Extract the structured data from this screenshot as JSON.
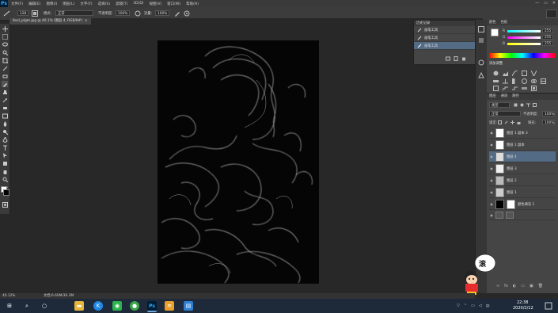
{
  "menubar": {
    "logo": "Ps",
    "items": [
      "文件(F)",
      "编辑(E)",
      "图像(I)",
      "图层(L)",
      "文字(Y)",
      "选择(S)",
      "滤镜(T)",
      "3D(D)",
      "视图(V)",
      "窗口(W)",
      "帮助(H)"
    ],
    "controls": [
      "—",
      "▭",
      "✕"
    ]
  },
  "optbar": {
    "size_value": "128",
    "mode_label": "模式:",
    "mode_value": "正常",
    "opacity_label": "不透明度:",
    "opacity_value": "100%",
    "flow_label": "流量:",
    "flow_value": "100%"
  },
  "document": {
    "tab_title": "8xxl_plgm.jpg @ 40.1% (图层 4, RGB/8#)",
    "tab_close": "×"
  },
  "history": {
    "header": "历史记录",
    "items": [
      "画笔工具",
      "画笔工具",
      "画笔工具"
    ],
    "selected_index": 2
  },
  "color": {
    "tabs": [
      "颜色",
      "色板"
    ],
    "channels": [
      {
        "label": "R",
        "value": "255"
      },
      {
        "label": "G",
        "value": "255"
      },
      {
        "label": "B",
        "value": "255"
      }
    ]
  },
  "adjustments": {
    "title": "添加调整"
  },
  "layers": {
    "tabs": [
      "图层",
      "通道",
      "路径"
    ],
    "kind_label": "类型",
    "blend_mode": "正常",
    "opacity_label": "不透明度:",
    "opacity_value": "100%",
    "lock_label": "锁定:",
    "fill_label": "填充:",
    "fill_value": "100%",
    "items": [
      {
        "name": "图层 1 副本 3",
        "selected": false
      },
      {
        "name": "图层 1 副本",
        "selected": false
      },
      {
        "name": "图层 4",
        "selected": true
      },
      {
        "name": "图层 3",
        "selected": false
      },
      {
        "name": "图层 2",
        "selected": false
      },
      {
        "name": "图层 1",
        "selected": false
      },
      {
        "name": "颜色填充 1",
        "selected": false
      }
    ],
    "footer_icons": [
      "∞",
      "fx",
      "◐",
      "▭",
      "▣",
      "🗑"
    ]
  },
  "status": {
    "zoom": "40.12%",
    "doc_size": "文档:6.60M/36.3M"
  },
  "taskbar": {
    "time": "22:38",
    "date": "2020/2/12",
    "ime": "中",
    "start_icon": "⊞",
    "search_icon": "⌕",
    "task_icon": "○",
    "apps": [
      {
        "name": "file-explorer-icon",
        "glyph": "▬",
        "color": "#e7b53a"
      },
      {
        "name": "kugou-icon",
        "glyph": "K",
        "color": "#1e88e5"
      },
      {
        "name": "wechat-icon",
        "glyph": "◉",
        "color": "#2bb24c"
      },
      {
        "name": "browser-icon",
        "glyph": "●",
        "color": "#3aa54a"
      },
      {
        "name": "photoshop-icon",
        "glyph": "Ps",
        "color": "#001d34"
      },
      {
        "name": "app-icon",
        "glyph": "≋",
        "color": "#e9a02b"
      },
      {
        "name": "store-icon",
        "glyph": "▤",
        "color": "#2d7fd3"
      }
    ]
  },
  "mascot": {
    "bubble_text": "滚"
  }
}
